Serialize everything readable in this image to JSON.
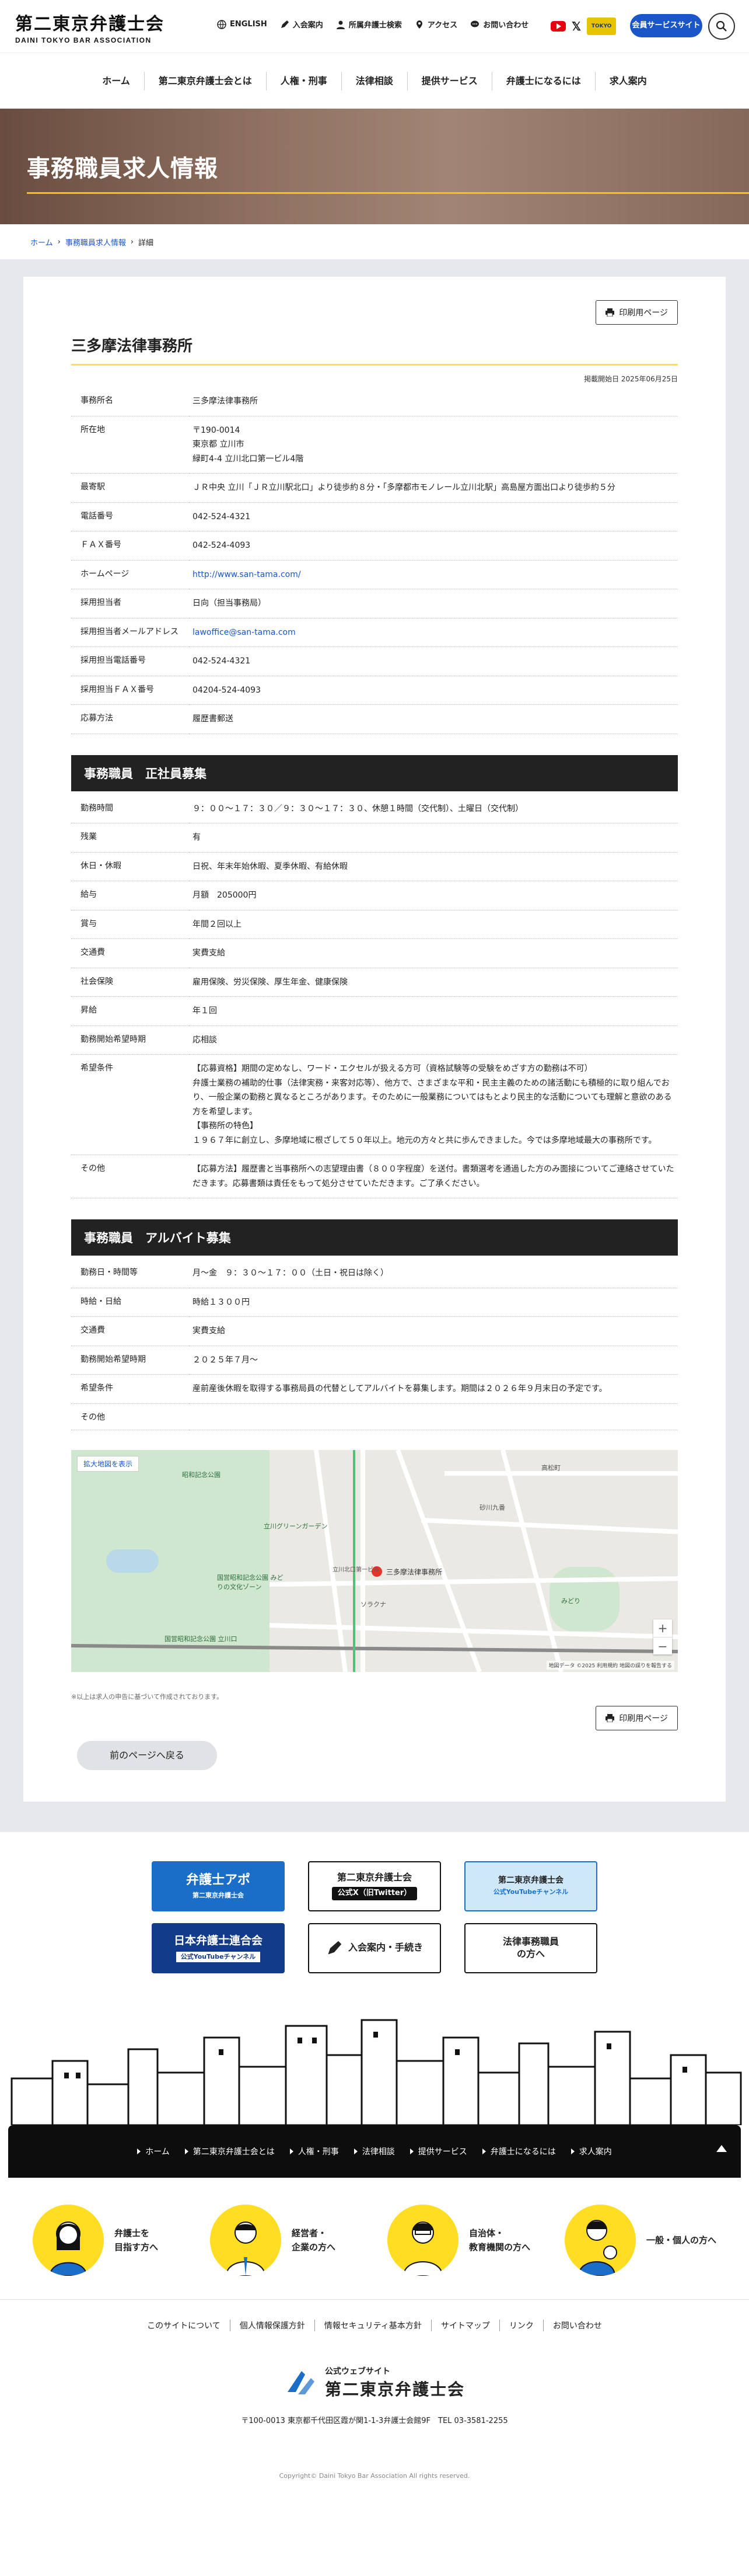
{
  "header": {
    "logo_jp": "第二東京弁護士会",
    "logo_en": "DAINI TOKYO BAR ASSOCIATION",
    "util": [
      "ENGLISH",
      "入会案内",
      "所属弁護士検索",
      "アクセス",
      "お問い合わせ"
    ],
    "tokyo_badge": "TOKYO",
    "member_btn": "会員サービスサイト"
  },
  "gnav": [
    "ホーム",
    "第二東京弁護士会とは",
    "人権・刑事",
    "法律相談",
    "提供サービス",
    "弁護士になるには",
    "求人案内"
  ],
  "hero": {
    "title": "事務職員求人情報"
  },
  "breadcrumb": {
    "home": "ホーム",
    "list": "事務職員求人情報",
    "current": "詳細"
  },
  "print_label": "印刷用ページ",
  "office": {
    "name": "三多摩法律事務所",
    "posted": "掲載開始日 2025年06月25日",
    "rows": [
      {
        "k": "事務所名",
        "v": "三多摩法律事務所"
      },
      {
        "k": "所在地",
        "lines": [
          "〒190-0014",
          "東京都 立川市",
          "緑町4-4 立川北口第一ビル4階"
        ]
      },
      {
        "k": "最寄駅",
        "v": "ＪＲ中央 立川「ＪＲ立川駅北口」より徒歩約８分・「多摩都市モノレール立川北駅」高島屋方面出口より徒歩約５分"
      },
      {
        "k": "電話番号",
        "v": "042-524-4321"
      },
      {
        "k": "ＦＡＸ番号",
        "v": "042-524-4093"
      },
      {
        "k": "ホームページ",
        "v": "http://www.san-tama.com/",
        "link": true
      },
      {
        "k": "採用担当者",
        "v": "日向（担当事務局）"
      },
      {
        "k": "採用担当者メールアドレス",
        "v": "lawoffice@san-tama.com",
        "link": true
      },
      {
        "k": "採用担当電話番号",
        "v": "042-524-4321"
      },
      {
        "k": "採用担当ＦＡＸ番号",
        "v": "04204-524-4093"
      },
      {
        "k": "応募方法",
        "v": "履歴書郵送"
      }
    ]
  },
  "fulltime": {
    "title": "事務職員　正社員募集",
    "rows": [
      {
        "k": "勤務時間",
        "v": "９：００～１７：３０／９：３０～１７：３０、休憩１時間（交代制）、土曜日（交代制）"
      },
      {
        "k": "残業",
        "v": "有"
      },
      {
        "k": "休日・休暇",
        "v": "日祝、年末年始休暇、夏季休暇、有給休暇"
      },
      {
        "k": "給与",
        "v": "月額　205000円"
      },
      {
        "k": "賞与",
        "v": "年間２回以上"
      },
      {
        "k": "交通費",
        "v": "実費支給"
      },
      {
        "k": "社会保険",
        "v": "雇用保険、労災保険、厚生年金、健康保険"
      },
      {
        "k": "昇給",
        "v": "年１回"
      },
      {
        "k": "勤務開始希望時期",
        "v": "応相談"
      },
      {
        "k": "希望条件",
        "lines": [
          "【応募資格】期間の定めなし、ワード・エクセルが扱える方可（資格試験等の受験をめざす方の勤務は不可）",
          "弁護士業務の補助的仕事（法律実務・来客対応等）、他方で、さまざまな平和・民主主義のための諸活動にも積極的に取り組んでおり、一般企業の勤務と異なるところがあります。そのために一般業務についてはもとより民主的な活動についても理解と意欲のある方を希望します。",
          "【事務所の特色】",
          "１９６７年に創立し、多摩地域に根ざして５０年以上。地元の方々と共に歩んできました。今では多摩地域最大の事務所です。"
        ]
      },
      {
        "k": "その他",
        "v": "【応募方法】履歴書と当事務所への志望理由書（８００字程度）を送付。書類選考を通過した方のみ面接についてご連絡させていただきます。応募書類は責任をもって処分させていただきます。ご了承ください。"
      }
    ]
  },
  "parttime": {
    "title": "事務職員　アルバイト募集",
    "rows": [
      {
        "k": "勤務日・時間等",
        "v": "月～金　９：３０～１７：００（土日・祝日は除く）"
      },
      {
        "k": "時給・日給",
        "v": "時給１３００円"
      },
      {
        "k": "交通費",
        "v": "実費支給"
      },
      {
        "k": "勤務開始希望時期",
        "v": "２０２５年７月～"
      },
      {
        "k": "希望条件",
        "v": "産前産後休暇を取得する事務局員の代替としてアルバイトを募集します。期間は２０２６年９月末日の予定です。"
      },
      {
        "k": "その他",
        "v": ""
      }
    ]
  },
  "map": {
    "enlarge": "拡大地図を表示",
    "pin_label": "三多摩法律事務所",
    "places": [
      "昭和記念公園",
      "国営昭和記念公園 みどりの文化ゾーン",
      "立川グリーンガーデン",
      "立川北口第一ビル",
      "ソラクナ",
      "高松町",
      "みどり",
      "砂川九番",
      "国営昭和記念公園 立川口"
    ],
    "credit": "地図データ ©2025 利用規約 地図の誤りを報告する"
  },
  "note": "※以上は求人の申告に基づいて作成されております。",
  "back_label": "前のページへ戻る",
  "banners": [
    {
      "text": "弁護士アポ",
      "sub": "第二東京弁護士会"
    },
    {
      "text": "第二東京弁護士会",
      "sub": "公式X（旧Twitter）"
    },
    {
      "text": "第二東京弁護士会",
      "sub": "公式YouTubeチャンネル"
    },
    {
      "text": "日本弁護士連合会",
      "sub": "公式YouTubeチャンネル"
    },
    {
      "text": "入会案内・手続き",
      "sub": ""
    },
    {
      "text": "法律事務職員",
      "sub": "の方へ"
    }
  ],
  "fnav": [
    "ホーム",
    "第二東京弁護士会とは",
    "人権・刑事",
    "法律相談",
    "提供サービス",
    "弁護士になるには",
    "求人案内"
  ],
  "personas": [
    {
      "l1": "弁護士を",
      "l2": "目指す方へ"
    },
    {
      "l1": "経営者・",
      "l2": "企業の方へ"
    },
    {
      "l1": "自治体・",
      "l2": "教育機関の方へ"
    },
    {
      "l1": "一般・個人の方へ",
      "l2": ""
    }
  ],
  "flinks": [
    "このサイトについて",
    "個人情報保護方針",
    "情報セキュリティ基本方針",
    "サイトマップ",
    "リンク",
    "お問い合わせ"
  ],
  "footer": {
    "small": "公式ウェブサイト",
    "name": "第二東京弁護士会",
    "address": "〒100-0013 東京都千代田区霞が関1-1-3弁護士会館9F　TEL 03-3581-2255",
    "copyright": "Copyright© Daini Tokyo Bar Association All rights reserved."
  }
}
